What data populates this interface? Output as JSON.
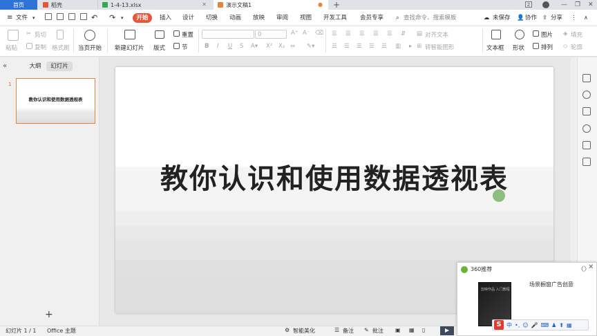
{
  "tabs": {
    "home": "首页",
    "daoke": "稻壳",
    "xlsx": "1-4-13.xlsx",
    "ppt": "演示文稿1",
    "new_tab": "+"
  },
  "window": {
    "badge": "2"
  },
  "menu": {
    "file": "文件",
    "start": "开始",
    "insert": "插入",
    "design": "设计",
    "transition": "切换",
    "animation": "动画",
    "slideshow": "放映",
    "review": "审阅",
    "view": "视图",
    "developer": "开发工具",
    "member": "会员专享",
    "search": "查找命令、搜索模板",
    "unsaved": "未保存",
    "collab": "协作",
    "share": "分享"
  },
  "ribbon": {
    "paste": "粘贴",
    "cut": "剪切",
    "copy": "复制",
    "format_painter": "格式刷",
    "play_current": "当页开始",
    "new_slide": "新建幻灯片",
    "layout": "版式",
    "reset": "重置",
    "section": "节",
    "font_size": "0",
    "align_text": "对齐文本",
    "smart_shape": "转智能图形",
    "textbox": "文本框",
    "shape": "形状",
    "picture": "图片",
    "fill": "填充",
    "arrange": "排列",
    "outline": "轮廓"
  },
  "leftpanel": {
    "outline_tab": "大纲",
    "slides_tab": "幻灯片",
    "slide_number": "1",
    "thumb_title": "教你认识和使用数据透视表",
    "add": "+"
  },
  "slide": {
    "title": "教你认识和使用数据透视表"
  },
  "status": {
    "slide_count": "幻灯片 1 / 1",
    "theme": "Office 主题",
    "smart_beautify": "智能美化",
    "notes": "备注",
    "comments": "批注"
  },
  "popup": {
    "title": "360推荐",
    "text": "场景橱窗广告创意",
    "book_title": "剪映作品 入门教程",
    "ime_label": "S",
    "ime_mode": "中"
  }
}
